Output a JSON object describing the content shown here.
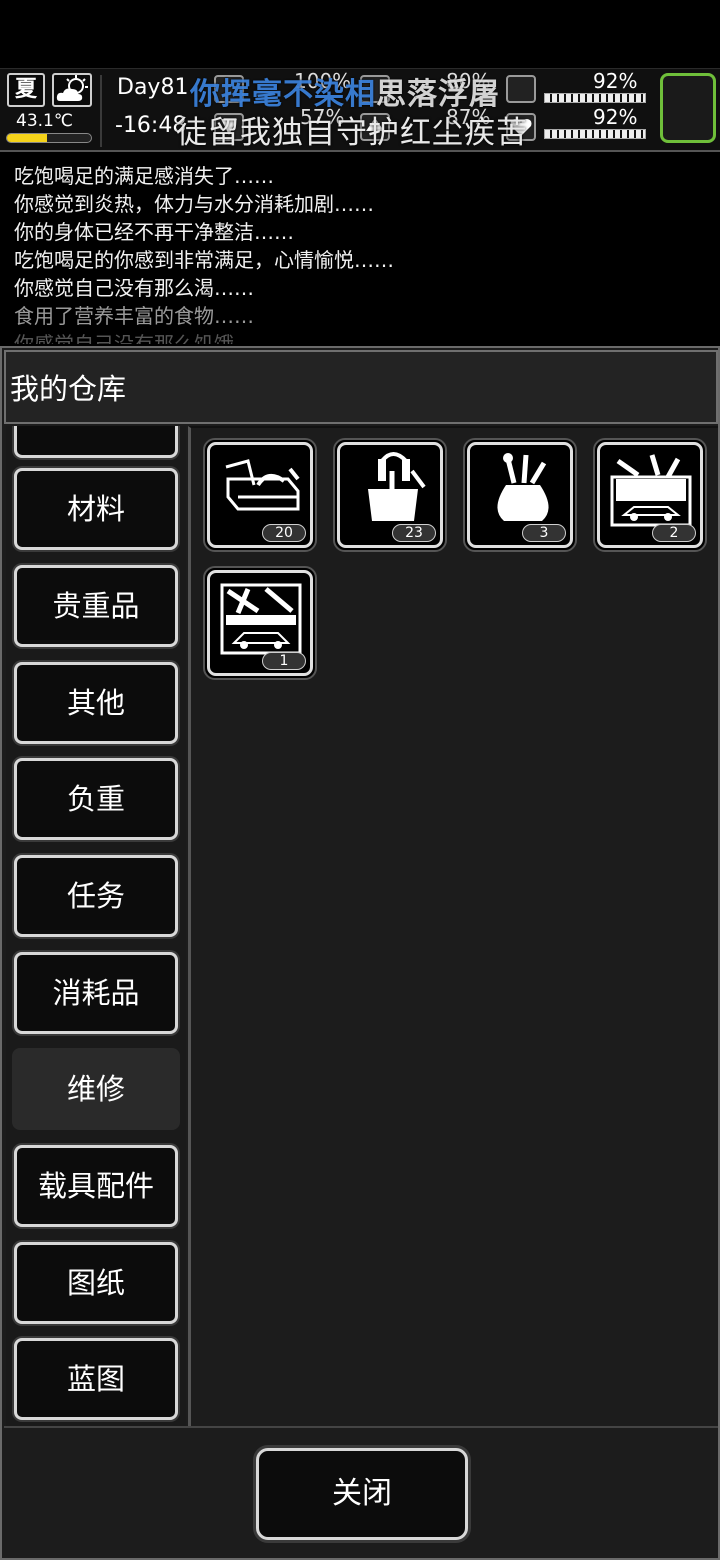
{
  "hud": {
    "season": "夏",
    "weather_icon": "partly-cloudy-icon",
    "temperature": "43.1℃",
    "temperature_level": 0.48,
    "day": "Day81",
    "time": "-16:48",
    "stats_top": [
      {
        "icon": "food-icon",
        "value": "100%"
      },
      {
        "icon": "water-icon",
        "value": "80%"
      }
    ],
    "stats_bottom": [
      {
        "icon": "energy-icon",
        "value": "57%"
      },
      {
        "icon": "stamina-icon",
        "value": "87%"
      }
    ],
    "bars": [
      {
        "icon": "mood-icon",
        "value": "92%"
      },
      {
        "icon": "health-icon",
        "value": "92%"
      }
    ],
    "lyric_line1_highlight": "你挥毫不染相",
    "lyric_line1_rest": "思落浮屠",
    "lyric_line2": "徒留我独自守护红尘疾苦"
  },
  "log": [
    "吃饱喝足的满足感消失了……",
    "你感觉到炎热，体力与水分消耗加剧……",
    "你的身体已经不再干净整洁……",
    "吃饱喝足的你感到非常满足，心情愉悦……",
    "你感觉自己没有那么渴……",
    "食用了营养丰富的食物……",
    "你感觉自己没有那么饥饿……"
  ],
  "warehouse": {
    "title": "我的仓库",
    "categories": [
      "材料",
      "贵重品",
      "其他",
      "负重",
      "任务",
      "消耗品",
      "维修",
      "载具配件",
      "图纸",
      "蓝图"
    ],
    "active_category": "维修",
    "items": [
      {
        "icon": "toolbox-with-tools-icon",
        "count": "20"
      },
      {
        "icon": "tool-bag-icon",
        "count": "23"
      },
      {
        "icon": "tool-sack-icon",
        "count": "3"
      },
      {
        "icon": "vehicle-repair-kit-icon",
        "count": "2"
      },
      {
        "icon": "vehicle-repair-kit-large-icon",
        "count": "1"
      }
    ],
    "close_label": "关闭"
  }
}
